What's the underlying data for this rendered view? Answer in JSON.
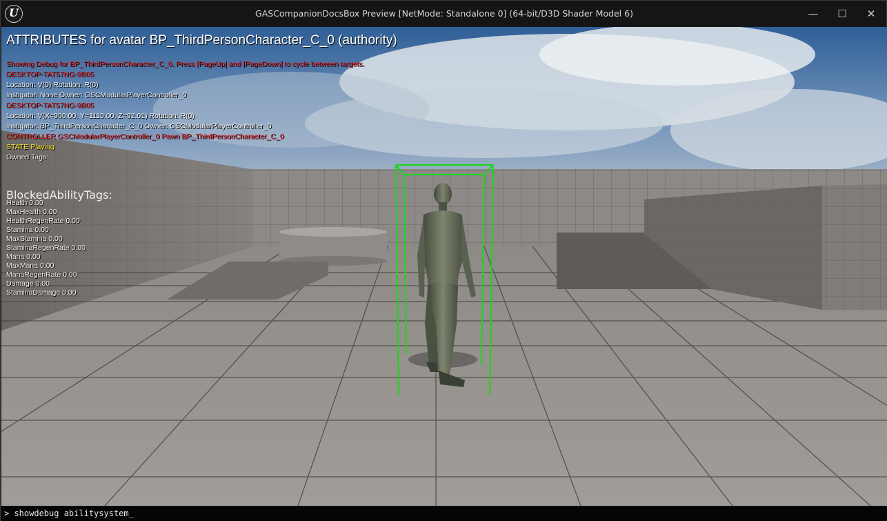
{
  "window": {
    "title": "GASCompanionDocsBox Preview [NetMode: Standalone 0]  (64-bit/D3D Shader Model 6)",
    "logo_letter": "U",
    "minimize_label": "—",
    "maximize_label": "☐",
    "close_label": "✕"
  },
  "hud": {
    "header": "ATTRIBUTES for avatar BP_ThirdPersonCharacter_C_0 (authority)",
    "debug_lines": [
      {
        "text": "Showing Debug for BP_ThirdPersonCharacter_C_0, Press [PageUp] and [PageDown] to cycle between targets.",
        "color": "red"
      },
      {
        "text": "DESKTOP-TAT57NG-9B05",
        "color": "red"
      },
      {
        "text": "Location: V(0) Rotation: R(0)",
        "color": "white"
      },
      {
        "text": " Instigator: None Owner: GSCModularPlayerController_0",
        "color": "white"
      },
      {
        "text": "DESKTOP-TAT57NG-9B05",
        "color": "red"
      },
      {
        "text": "Location: V(X=900.00, Y=1110.00, Z=92.01) Rotation: R(0)",
        "color": "white"
      },
      {
        "text": " Instigator: BP_ThirdPersonCharacter_C_0 Owner: GSCModularPlayerController_0",
        "color": "white"
      },
      {
        "text": "CONTROLLER GSCModularPlayerController_0 Pawn BP_ThirdPersonCharacter_C_0",
        "color": "red"
      },
      {
        "text": "STATE Playing",
        "color": "yellow"
      },
      {
        "text": "Owned Tags:",
        "color": "white"
      }
    ],
    "blocked_tags_label": "BlockedAbilityTags:",
    "attributes": [
      "Health 0.00",
      "MaxHealth 0.00",
      "HealthRegenRate 0.00",
      "Stamina 0.00",
      "MaxStamina 0.00",
      "StaminaRegenRate 0.00",
      "Mana 0.00",
      "MaxMana 0.00",
      "ManaRegenRate 0.00",
      "Damage 0.00",
      "StaminaDamage 0.00"
    ]
  },
  "console": {
    "input_value": "> showdebug abilitysystem_"
  },
  "colors": {
    "red": "#e21a1a",
    "white": "#f0f0f0",
    "yellow": "#f2e02a",
    "debug_box": "#22d322"
  }
}
